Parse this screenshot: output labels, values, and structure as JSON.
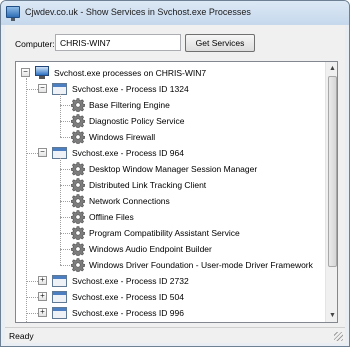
{
  "window": {
    "title": "Cjwdev.co.uk - Show Services in Svchost.exe Processes"
  },
  "toolbar": {
    "computer_label": "Computer:",
    "computer_value": "CHRIS-WIN7",
    "get_services_label": "Get Services"
  },
  "tree": {
    "root_label": "Svchost.exe processes on CHRIS-WIN7",
    "processes": [
      {
        "label": "Svchost.exe - Process ID 1324",
        "expanded": true,
        "services": [
          "Base Filtering Engine",
          "Diagnostic Policy Service",
          "Windows Firewall"
        ]
      },
      {
        "label": "Svchost.exe - Process ID 964",
        "expanded": true,
        "services": [
          "Desktop Window Manager Session Manager",
          "Distributed Link Tracking Client",
          "Network Connections",
          "Offline Files",
          "Program Compatibility Assistant Service",
          "Windows Audio Endpoint Builder",
          "Windows Driver Foundation - User-mode Driver Framework"
        ]
      },
      {
        "label": "Svchost.exe - Process ID 2732",
        "expanded": false,
        "services": []
      },
      {
        "label": "Svchost.exe - Process ID 504",
        "expanded": false,
        "services": []
      },
      {
        "label": "Svchost.exe - Process ID 996",
        "expanded": false,
        "services": []
      }
    ]
  },
  "status": {
    "text": "Ready"
  },
  "icons": {
    "root": "computer-icon",
    "process": "window-icon",
    "service": "gear-icon"
  }
}
